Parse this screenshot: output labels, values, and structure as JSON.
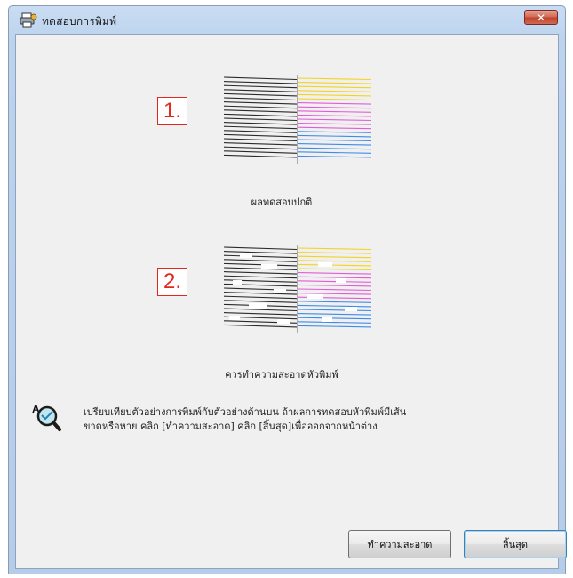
{
  "window": {
    "title": "ทดสอบการพิมพ์",
    "close_symbol": "✕"
  },
  "patterns": [
    {
      "number": "1.",
      "caption": "ผลทดสอบปกติ",
      "state": "normal"
    },
    {
      "number": "2.",
      "caption": "ควรทำความสะอาดหัวพิมพ์",
      "state": "missing-segments"
    }
  ],
  "info": {
    "icon": "magnifier-icon",
    "line1": "เปรียบเทียบตัวอย่างการพิมพ์กับตัวอย่างด้านบน ถ้าผลการทดสอบหัวพิมพ์มีเส้น",
    "line2": "ขาดหรือหาย คลิก [ทำความสะอาด] คลิก [สิ้นสุด]เพื่อออกจากหน้าต่าง"
  },
  "buttons": {
    "clean": "ทำความสะอาด",
    "finish": "สิ้นสุด"
  },
  "colors": {
    "black_lines": "#2a2a2a",
    "yellow_lines": "#f2d321",
    "magenta_lines": "#e35bd6",
    "cyan_lines": "#3d8be8",
    "number_red": "#e0281f"
  }
}
